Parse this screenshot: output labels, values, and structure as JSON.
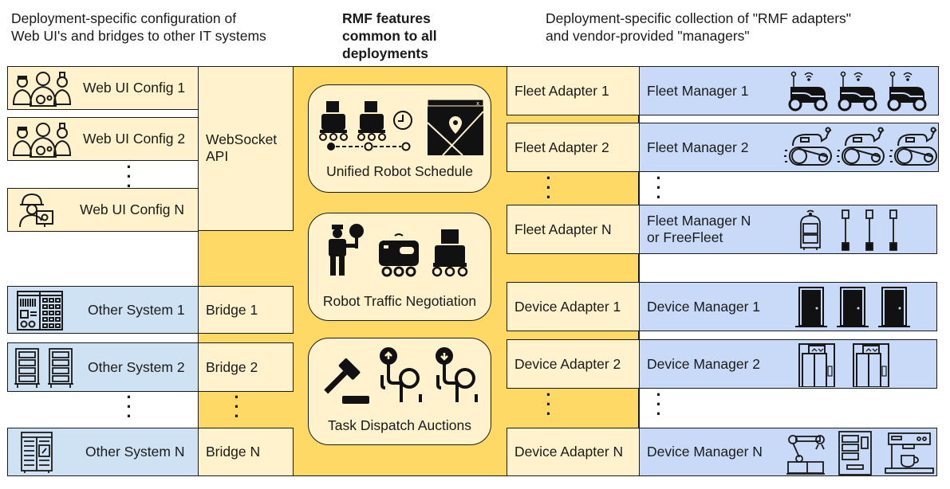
{
  "headers": {
    "left": [
      "Deployment-specific configuration of",
      "Web UI's and bridges to other IT systems"
    ],
    "center": [
      "RMF features",
      "common to all",
      "deployments"
    ],
    "right": [
      "Deployment-specific collection of \"RMF adapters\"",
      "and vendor-provided \"managers\""
    ]
  },
  "web_ui_configs": [
    {
      "label": "Web UI Config 1",
      "icon": "medical-staff-icon"
    },
    {
      "label": "Web UI Config 2",
      "icon": "medical-staff-icon"
    },
    {
      "label": "Web UI Config N",
      "icon": "engineer-computer-icon"
    }
  ],
  "websocket_api": [
    "WebSocket",
    "API"
  ],
  "other_systems": [
    {
      "label": "Other System 1",
      "icon": "control-panel-icon"
    },
    {
      "label": "Other System 2",
      "icon": "server-racks-icon"
    },
    {
      "label": "Other System N",
      "icon": "server-cabinet-icon"
    }
  ],
  "bridges": [
    "Bridge 1",
    "Bridge 2",
    "Bridge N"
  ],
  "features": [
    {
      "label": "Unified Robot Schedule",
      "icons": [
        "delivery-robot-icon",
        "delivery-robot-icon",
        "clock-icon",
        "map-pin-icon"
      ]
    },
    {
      "label": "Robot Traffic Negotiation",
      "icons": [
        "traffic-officer-icon",
        "shuttle-robot-icon",
        "delivery-robot-icon"
      ]
    },
    {
      "label": "Task Dispatch Auctions",
      "icons": [
        "gavel-icon",
        "bidder-up-icon",
        "bidder-down-icon"
      ]
    }
  ],
  "fleet_adapters": [
    "Fleet Adapter 1",
    "Fleet Adapter 2",
    "Fleet Adapter N"
  ],
  "fleet_managers": [
    {
      "label": [
        "Fleet Manager 1"
      ],
      "icon": "wifi-robot-icon"
    },
    {
      "label": [
        "Fleet Manager 2"
      ],
      "icon": "tracked-robot-icon"
    },
    {
      "label": [
        "Fleet Manager N",
        "or FreeFleet"
      ],
      "icon": "freefleet-robots-icon"
    }
  ],
  "device_adapters": [
    "Device Adapter 1",
    "Device Adapter 2",
    "Device Adapter N"
  ],
  "device_managers": [
    {
      "label": "Device Manager 1",
      "icon": "door-icon"
    },
    {
      "label": "Device Manager 2",
      "icon": "elevator-icon"
    },
    {
      "label": "Device Manager N",
      "icon": "misc-devices-icon"
    }
  ],
  "colors": {
    "cream": "#fff2cc",
    "gold": "#ffd966",
    "light_blue": "#cfe2f3",
    "periwinkle": "#c9daf8",
    "outline": "#1a1a1a"
  }
}
